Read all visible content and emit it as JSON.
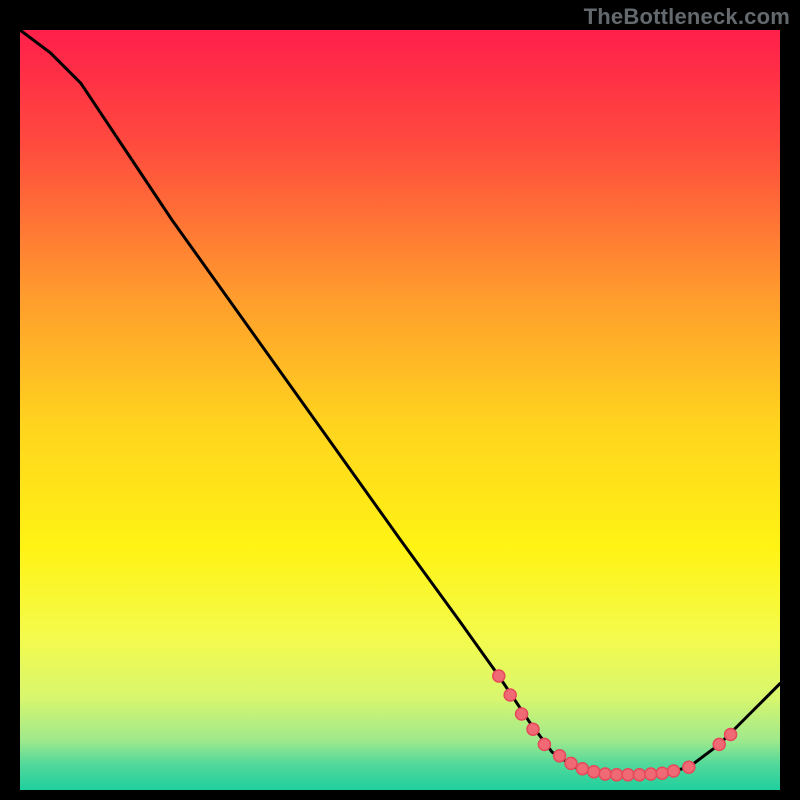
{
  "attribution": "TheBottleneck.com",
  "chart_data": {
    "type": "line",
    "title": "",
    "xlabel": "",
    "ylabel": "",
    "xlim": [
      0,
      100
    ],
    "ylim": [
      0,
      100
    ],
    "background": {
      "type": "vertical_gradient",
      "stops": [
        {
          "pos": 0.0,
          "color": "#ff1f4b"
        },
        {
          "pos": 0.15,
          "color": "#ff4a3e"
        },
        {
          "pos": 0.35,
          "color": "#ff9c2d"
        },
        {
          "pos": 0.52,
          "color": "#ffd41e"
        },
        {
          "pos": 0.68,
          "color": "#fff314"
        },
        {
          "pos": 0.8,
          "color": "#f4fb4d"
        },
        {
          "pos": 0.88,
          "color": "#d7f66e"
        },
        {
          "pos": 0.935,
          "color": "#9ee98c"
        },
        {
          "pos": 0.965,
          "color": "#54d99a"
        },
        {
          "pos": 1.0,
          "color": "#1fcf9e"
        }
      ]
    },
    "curve": [
      {
        "x": 0,
        "y": 100
      },
      {
        "x": 4,
        "y": 97
      },
      {
        "x": 8,
        "y": 93
      },
      {
        "x": 12,
        "y": 87
      },
      {
        "x": 20,
        "y": 75
      },
      {
        "x": 30,
        "y": 61
      },
      {
        "x": 40,
        "y": 47
      },
      {
        "x": 50,
        "y": 33
      },
      {
        "x": 58,
        "y": 22
      },
      {
        "x": 63,
        "y": 15
      },
      {
        "x": 67,
        "y": 9
      },
      {
        "x": 70,
        "y": 5
      },
      {
        "x": 73,
        "y": 3
      },
      {
        "x": 76,
        "y": 2
      },
      {
        "x": 80,
        "y": 2
      },
      {
        "x": 84,
        "y": 2
      },
      {
        "x": 88,
        "y": 3
      },
      {
        "x": 92,
        "y": 6
      },
      {
        "x": 96,
        "y": 10
      },
      {
        "x": 100,
        "y": 14
      }
    ],
    "markers": [
      {
        "x": 63,
        "y": 15
      },
      {
        "x": 64.5,
        "y": 12.5
      },
      {
        "x": 66,
        "y": 10
      },
      {
        "x": 67.5,
        "y": 8
      },
      {
        "x": 69,
        "y": 6
      },
      {
        "x": 71,
        "y": 4.5
      },
      {
        "x": 72.5,
        "y": 3.5
      },
      {
        "x": 74,
        "y": 2.8
      },
      {
        "x": 75.5,
        "y": 2.4
      },
      {
        "x": 77,
        "y": 2.1
      },
      {
        "x": 78.5,
        "y": 2.0
      },
      {
        "x": 80,
        "y": 2.0
      },
      {
        "x": 81.5,
        "y": 2.0
      },
      {
        "x": 83,
        "y": 2.1
      },
      {
        "x": 84.5,
        "y": 2.2
      },
      {
        "x": 86,
        "y": 2.5
      },
      {
        "x": 88,
        "y": 3.0
      },
      {
        "x": 92,
        "y": 6.0
      },
      {
        "x": 93.5,
        "y": 7.3
      }
    ],
    "marker_style": {
      "fill": "#ef6a74",
      "stroke": "#e6495a",
      "r": 6
    },
    "line_style": {
      "stroke": "#000000",
      "width": 3
    }
  }
}
